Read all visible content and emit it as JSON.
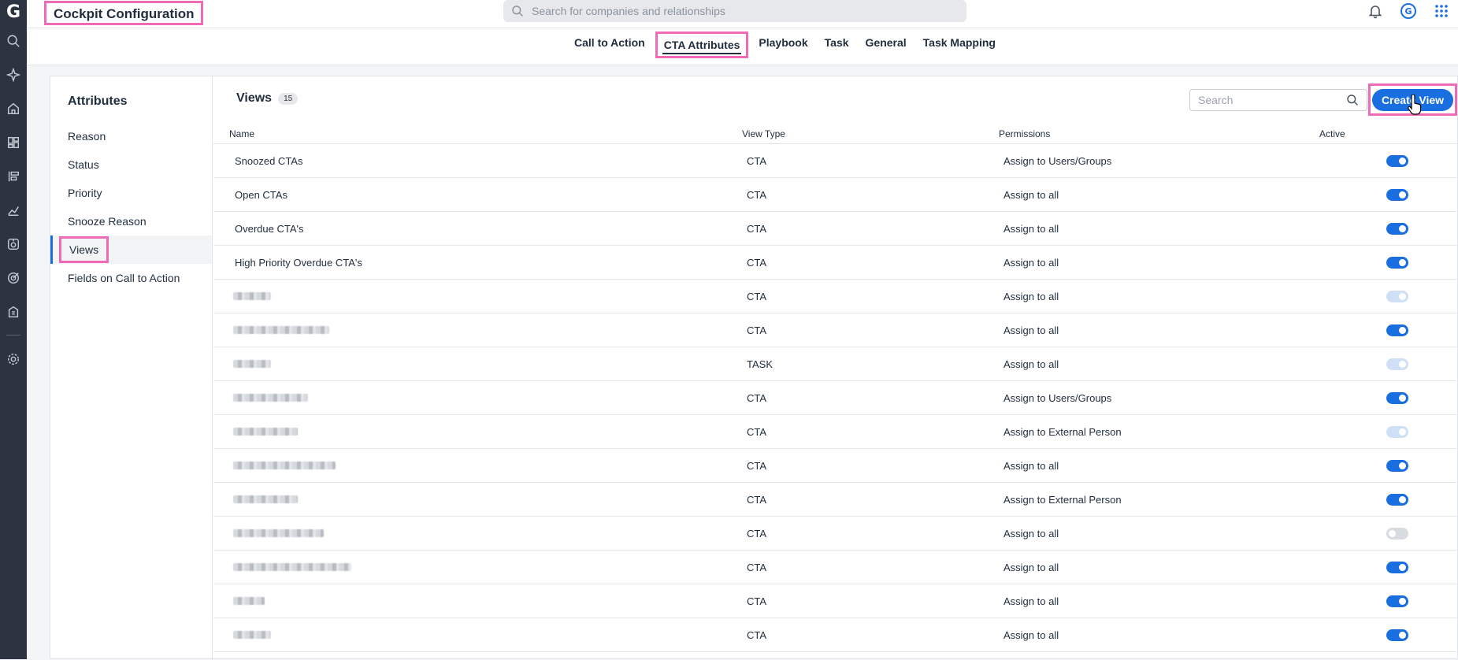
{
  "app": {
    "logo": "G",
    "title": "Cockpit Configuration"
  },
  "search": {
    "placeholder": "Search for companies and relationships"
  },
  "tabs": [
    {
      "label": "Call to Action",
      "active": false
    },
    {
      "label": "CTA Attributes",
      "active": true
    },
    {
      "label": "Playbook",
      "active": false
    },
    {
      "label": "Task",
      "active": false
    },
    {
      "label": "General",
      "active": false
    },
    {
      "label": "Task Mapping",
      "active": false
    }
  ],
  "attributes": {
    "title": "Attributes",
    "items": [
      {
        "label": "Reason"
      },
      {
        "label": "Status"
      },
      {
        "label": "Priority"
      },
      {
        "label": "Snooze Reason"
      },
      {
        "label": "Views",
        "active": true
      },
      {
        "label": "Fields on Call to Action"
      }
    ]
  },
  "views": {
    "title": "Views",
    "count": "15",
    "search_placeholder": "Search",
    "create_label": "Create View",
    "columns": {
      "name": "Name",
      "type": "View Type",
      "permissions": "Permissions",
      "active": "Active"
    },
    "rows": [
      {
        "name": "Snoozed CTAs",
        "type": "CTA",
        "permissions": "Assign to Users/Groups",
        "active": "on"
      },
      {
        "name": "Open CTAs",
        "type": "CTA",
        "permissions": "Assign to all",
        "active": "on"
      },
      {
        "name": "Overdue CTA's",
        "type": "CTA",
        "permissions": "Assign to all",
        "active": "on"
      },
      {
        "name": "High Priority Overdue CTA's",
        "type": "CTA",
        "permissions": "Assign to all",
        "active": "on"
      },
      {
        "name": "",
        "type": "CTA",
        "permissions": "Assign to all",
        "active": "pale"
      },
      {
        "name": "",
        "type": "CTA",
        "permissions": "Assign to all",
        "active": "on"
      },
      {
        "name": "",
        "type": "TASK",
        "permissions": "Assign to all",
        "active": "pale"
      },
      {
        "name": "",
        "type": "CTA",
        "permissions": "Assign to Users/Groups",
        "active": "on"
      },
      {
        "name": "",
        "type": "CTA",
        "permissions": "Assign to External Person",
        "active": "pale"
      },
      {
        "name": "",
        "type": "CTA",
        "permissions": "Assign to all",
        "active": "on"
      },
      {
        "name": "",
        "type": "CTA",
        "permissions": "Assign to External Person",
        "active": "on"
      },
      {
        "name": "",
        "type": "CTA",
        "permissions": "Assign to all",
        "active": "off"
      },
      {
        "name": "",
        "type": "CTA",
        "permissions": "Assign to all",
        "active": "on"
      },
      {
        "name": "",
        "type": "CTA",
        "permissions": "Assign to all",
        "active": "on"
      },
      {
        "name": "",
        "type": "CTA",
        "permissions": "Assign to all",
        "active": "on"
      }
    ]
  },
  "colors": {
    "accent": "#1a6fe0",
    "highlight": "#f06bb5",
    "rail": "#2b3440"
  }
}
